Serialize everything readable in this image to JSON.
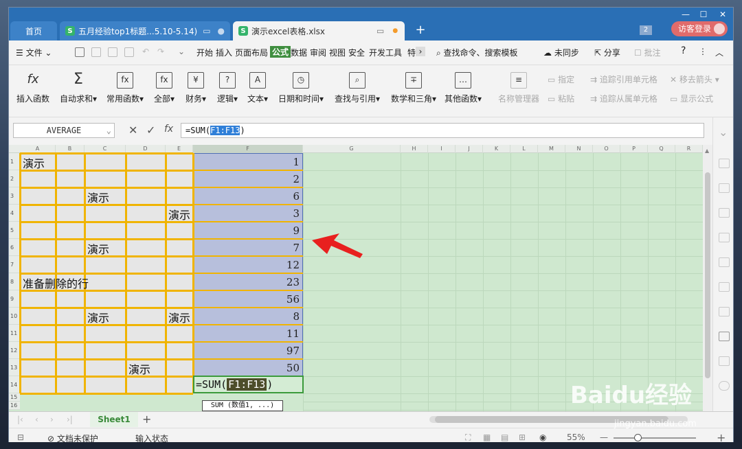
{
  "tabs": [
    {
      "label": "首页"
    },
    {
      "label": "五月经验top1标题...5.10-5.14)"
    },
    {
      "label": "演示excel表格.xlsx"
    }
  ],
  "titlebar": {
    "badge": "2",
    "login": "访客登录"
  },
  "menu": {
    "file": "文件",
    "items": [
      "开始",
      "插入",
      "页面布局",
      "公式",
      "数据",
      "审阅",
      "视图",
      "安全",
      "开发工具",
      "特"
    ],
    "search": "查找命令、搜索模板",
    "sync": "未同步",
    "share": "分享",
    "comment": "批注"
  },
  "ribbon": {
    "buttons": [
      {
        "label": "插入函数",
        "icon": "fx"
      },
      {
        "label": "自动求和",
        "icon": "Σ"
      },
      {
        "label": "常用函数",
        "icon": "fx"
      },
      {
        "label": "全部",
        "icon": "fx"
      },
      {
        "label": "财务",
        "icon": "¥"
      },
      {
        "label": "逻辑",
        "icon": "?"
      },
      {
        "label": "文本",
        "icon": "A"
      },
      {
        "label": "日期和时间",
        "icon": "◷"
      },
      {
        "label": "查找与引用",
        "icon": "⌕"
      },
      {
        "label": "数学和三角",
        "icon": "∓"
      },
      {
        "label": "其他函数",
        "icon": "…"
      },
      {
        "label": "名称管理器",
        "icon": "≡"
      }
    ],
    "small": [
      "指定",
      "粘贴",
      "追踪引用单元格",
      "追踪从属单元格",
      "移去箭头",
      "显示公式"
    ]
  },
  "formula_bar": {
    "name_box": "AVERAGE",
    "formula_prefix": "=SUM(",
    "formula_ref": "F1:F13",
    "formula_suffix": ")"
  },
  "columns": [
    "A",
    "B",
    "C",
    "D",
    "E",
    "F",
    "G",
    "H",
    "I",
    "J",
    "K",
    "L",
    "M",
    "N",
    "O",
    "P",
    "Q",
    "R"
  ],
  "rows": [
    "1",
    "2",
    "3",
    "4",
    "5",
    "6",
    "7",
    "8",
    "9",
    "10",
    "11",
    "12",
    "13",
    "14",
    "15",
    "16"
  ],
  "cells": {
    "a1": "演示",
    "c3": "演示",
    "e4": "演示",
    "c6": "演示",
    "a8": "准备删除的行",
    "c10": "演示",
    "e10": "演示",
    "d13": "演示"
  },
  "f_values": [
    "1",
    "2",
    "6",
    "3",
    "9",
    "7",
    "12",
    "23",
    "56",
    "8",
    "11",
    "97",
    "50"
  ],
  "edit_cell": {
    "prefix": "=SUM(",
    "ref": "F1:F13",
    "suffix": ")"
  },
  "tooltip": "SUM (数值1, ...)",
  "sheet_tab": "Sheet1",
  "status": {
    "protect": "文档未保护",
    "mode": "输入状态",
    "zoom": "55%"
  },
  "watermark": {
    "brand": "Baidu经验",
    "url": "jingyan.baidu.com"
  },
  "colors": {
    "accent": "#3f8e3f",
    "titlebar": "#2a6fb5",
    "selection": "#b7bfdc",
    "border_yellow": "#f0b400"
  }
}
